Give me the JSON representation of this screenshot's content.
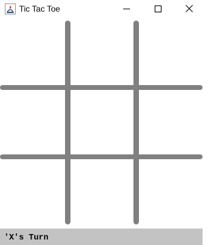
{
  "window": {
    "title": "Tic Tac Toe",
    "icon": "java-app-icon",
    "controls": [
      "minimize-icon",
      "maximize-icon",
      "close-icon"
    ]
  },
  "board": {
    "rows": 3,
    "cols": 3,
    "cells": [
      "",
      "",
      "",
      "",
      "",
      "",
      "",
      "",
      ""
    ],
    "line_color": "#808080"
  },
  "status": {
    "text": "'X's Turn",
    "background": "#c3c3c3"
  }
}
